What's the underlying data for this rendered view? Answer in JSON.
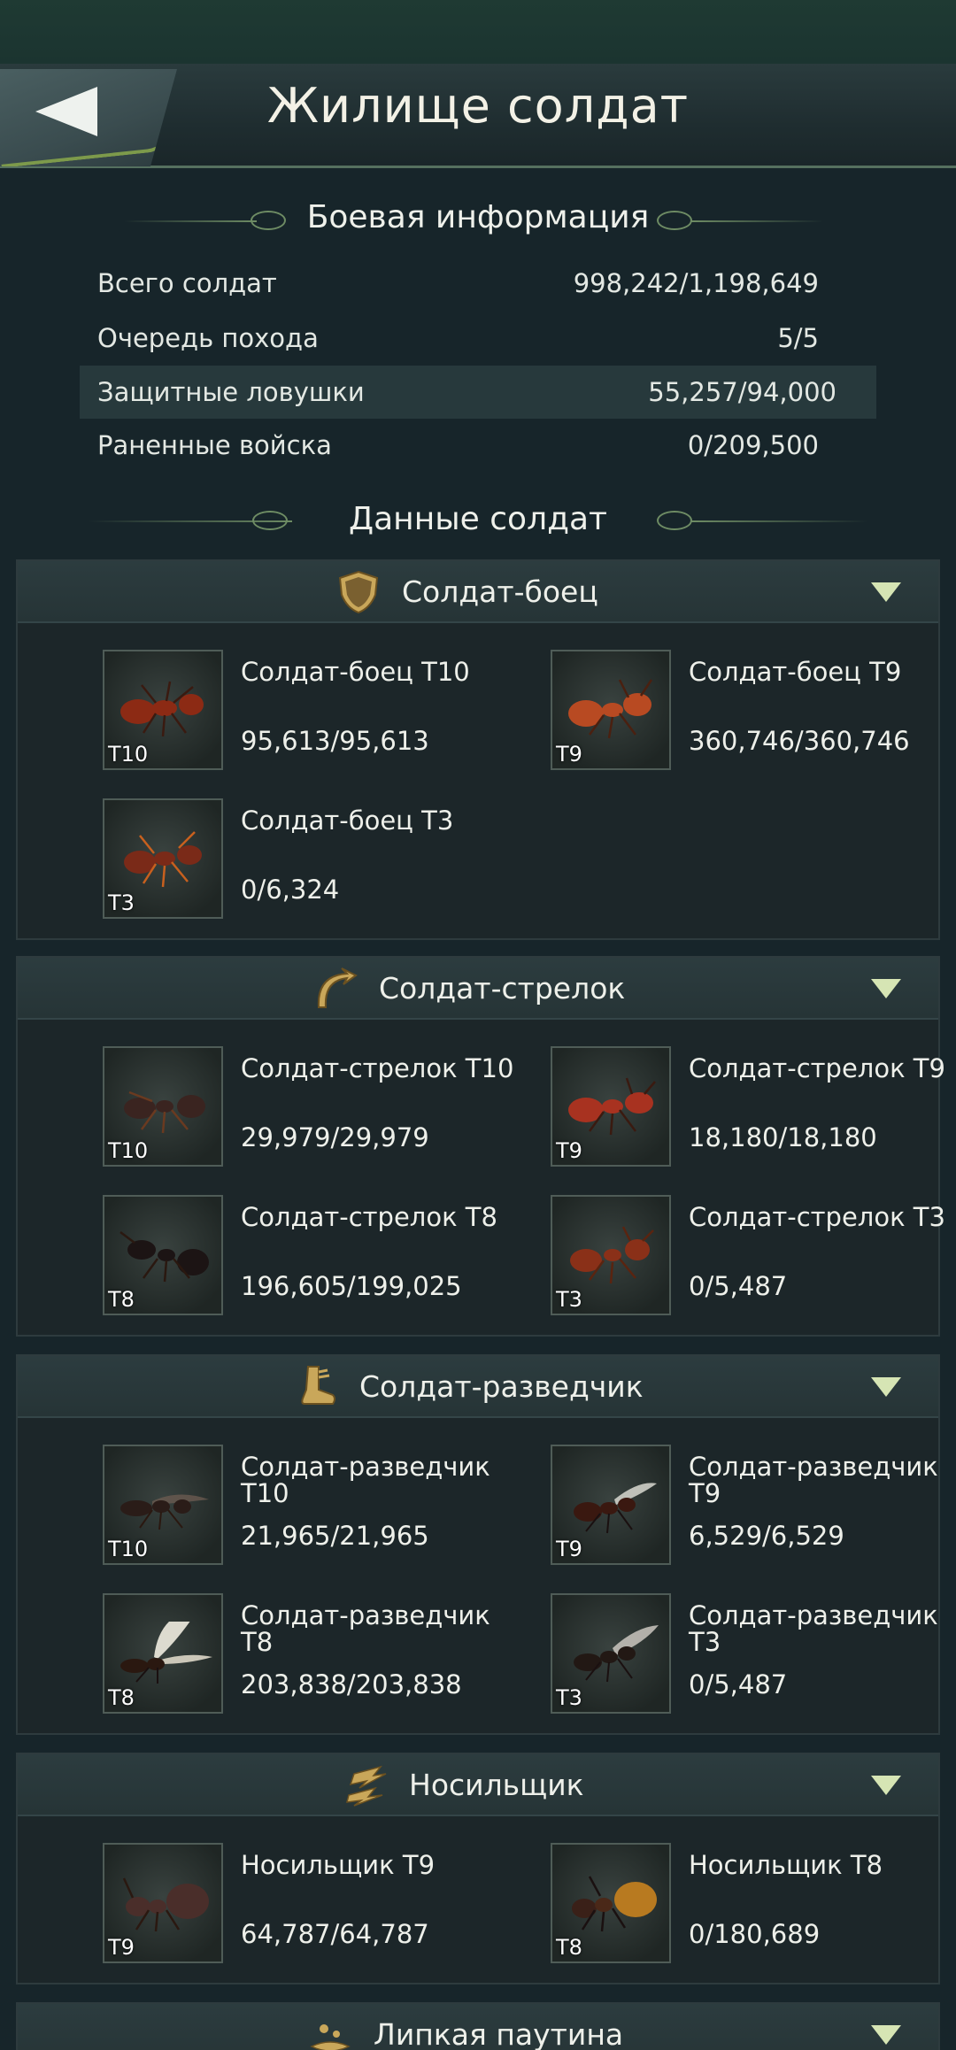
{
  "header": {
    "title": "Жилище солдат"
  },
  "battle_info": {
    "heading": "Боевая информация",
    "rows": [
      {
        "label": "Всего солдат",
        "value": "998,242/1,198,649"
      },
      {
        "label": "Очередь похода",
        "value": "5/5"
      },
      {
        "label": "Защитные ловушки",
        "value": "55,257/94,000"
      },
      {
        "label": "Раненные войска",
        "value": "0/209,500"
      }
    ]
  },
  "soldier_data": {
    "heading": "Данные солдат"
  },
  "categories": [
    {
      "title": "Солдат-боец",
      "icon": "shield-icon",
      "units": [
        {
          "name": "Солдат-боец Т10",
          "count": "95,613/95,613",
          "tier": "T10",
          "color": "#8c2a14"
        },
        {
          "name": "Солдат-боец Т9",
          "count": "360,746/360,746",
          "tier": "T9",
          "color": "#b84a22"
        },
        {
          "name": "Солдат-боец Т3",
          "count": "0/6,324",
          "tier": "T3",
          "color": "#7a2a18"
        }
      ]
    },
    {
      "title": "Солдат-стрелок",
      "icon": "curved-arrow-icon",
      "units": [
        {
          "name": "Солдат-стрелок Т10",
          "count": "29,979/29,979",
          "tier": "T10",
          "color": "#3a2420"
        },
        {
          "name": "Солдат-стрелок Т9",
          "count": "18,180/18,180",
          "tier": "T9",
          "color": "#a83220"
        },
        {
          "name": "Солдат-стрелок Т8",
          "count": "196,605/199,025",
          "tier": "T8",
          "color": "#1c1414"
        },
        {
          "name": "Солдат-стрелок Т3",
          "count": "0/5,487",
          "tier": "T3",
          "color": "#8a3018"
        }
      ]
    },
    {
      "title": "Солдат-разведчик",
      "icon": "boot-icon",
      "units": [
        {
          "name": "Солдат-разведчик Т10",
          "count": "21,965/21,965",
          "tier": "T10",
          "color": "#2a1c18"
        },
        {
          "name": "Солдат-разведчик Т9",
          "count": "6,529/6,529",
          "tier": "T9",
          "color": "#3a1810"
        },
        {
          "name": "Солдат-разведчик Т8",
          "count": "203,838/203,838",
          "tier": "T8",
          "color": "#2a1810"
        },
        {
          "name": "Солдат-разведчик Т3",
          "count": "0/5,487",
          "tier": "T3",
          "color": "#221814"
        }
      ]
    },
    {
      "title": "Носильщик",
      "icon": "lightning-icon",
      "units": [
        {
          "name": "Носильщик Т9",
          "count": "64,787/64,787",
          "tier": "T9",
          "color": "#4a2e2a"
        },
        {
          "name": "Носильщик Т8",
          "count": "0/180,689",
          "tier": "T8",
          "color": "#b87a20"
        }
      ]
    },
    {
      "title": "Липкая паутина",
      "icon": "web-icon",
      "units": []
    }
  ]
}
